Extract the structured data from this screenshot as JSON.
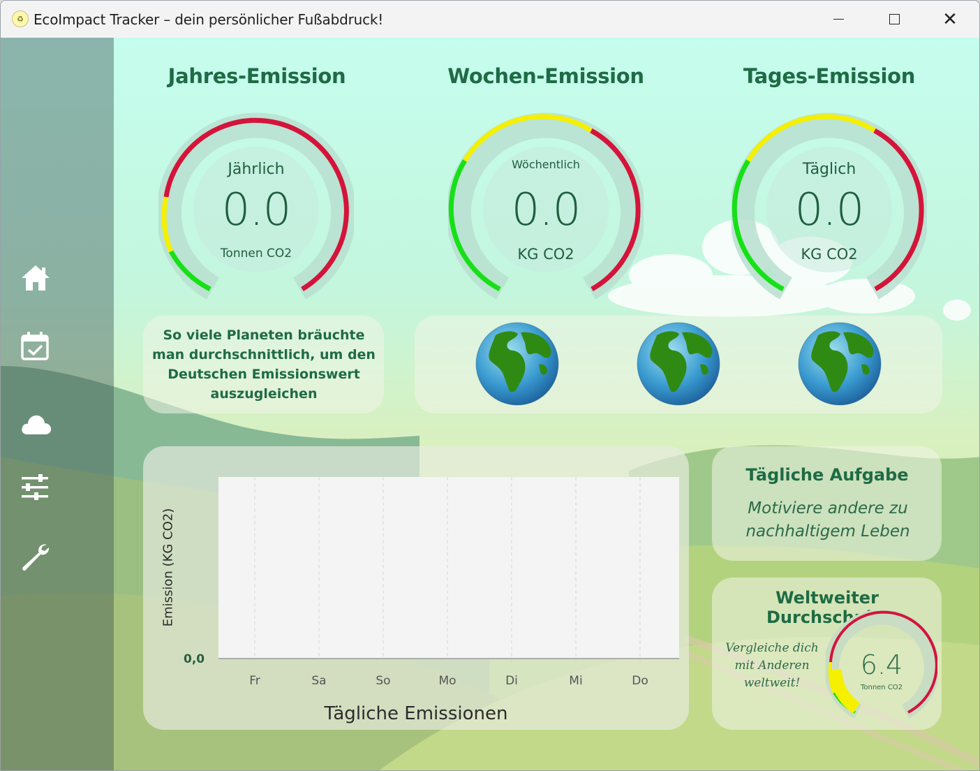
{
  "window": {
    "title": "EcoImpact Tracker – dein persönlicher Fußabdruck!",
    "app_icon_glyph": "♻",
    "minimize_icon": "minimize-icon",
    "maximize_icon": "maximize-icon",
    "close_glyph": "✕"
  },
  "sidebar": {
    "items": [
      {
        "name": "home",
        "icon": "home-icon"
      },
      {
        "name": "calendar",
        "icon": "calendar-check-icon"
      },
      {
        "name": "cloud",
        "icon": "cloud-icon"
      },
      {
        "name": "settings",
        "icon": "sliders-icon"
      },
      {
        "name": "tools",
        "icon": "wrench-icon"
      }
    ]
  },
  "gauges": {
    "annual": {
      "title": "Jahres-Emission",
      "label": "Jährlich",
      "value": "0.0",
      "unit": "Tonnen CO2",
      "level": 0.0
    },
    "weekly": {
      "title": "Wochen-Emission",
      "label": "Wöchentlich",
      "value": "0.0",
      "unit": "KG CO2",
      "level": 0.0
    },
    "daily": {
      "title": "Tages-Emission",
      "label": "Täglich",
      "value": "0.0",
      "unit": "KG CO2",
      "level": 0.0
    }
  },
  "planets": {
    "text": "So viele Planeten bräuchte man durchschnittlich, um den Deutschen Emissionswert auszugleichen",
    "count": 3
  },
  "task": {
    "title": "Tägliche Aufgabe",
    "text": "Motiviere andere zu nachhaltigem Leben"
  },
  "world_average": {
    "title": "Weltweiter Durchschnitt",
    "text": "Vergleiche dich mit Anderen weltweit!",
    "value": "6.4",
    "unit": "Tonnen CO2"
  },
  "chart_data": {
    "type": "bar",
    "title": "Tägliche Emissionen",
    "ylabel": "Emission (KG CO2)",
    "xlabel": "",
    "categories": [
      "Fr",
      "Sa",
      "So",
      "Mo",
      "Di",
      "Mi",
      "Do"
    ],
    "values": [
      0,
      0,
      0,
      0,
      0,
      0,
      0
    ],
    "y_tick_labels": [
      "0,0"
    ],
    "grid": "vertical dashed",
    "colors": {
      "plot_bg": "#f4f4f4",
      "grid": "#d6d6d6"
    }
  },
  "colors": {
    "accent_green": "#1e6b45",
    "gauge_red": "#d4143a",
    "gauge_yellow": "#f5f000",
    "gauge_green": "#17e017",
    "gauge_track": "#b9dfd0"
  }
}
